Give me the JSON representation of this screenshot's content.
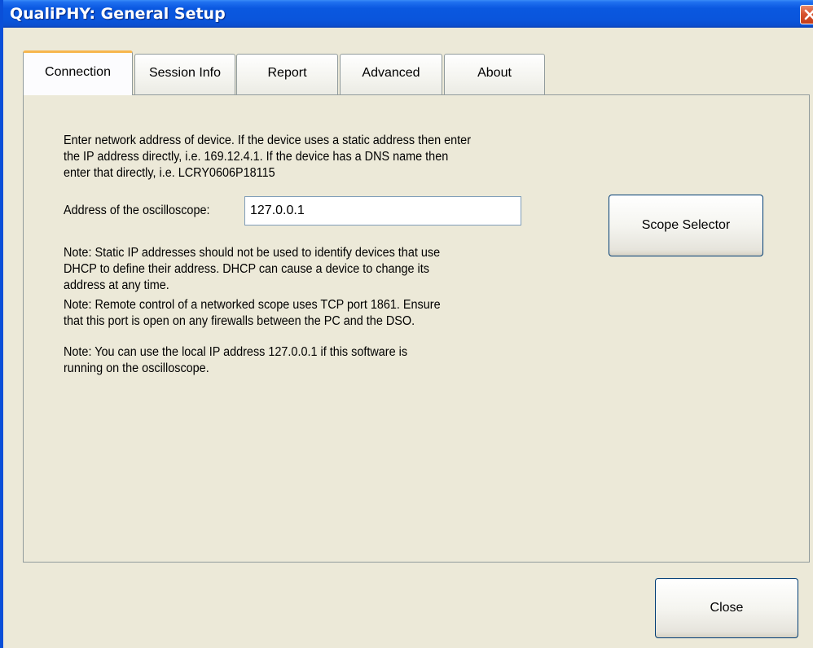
{
  "window": {
    "title": "QualiPHY: General Setup"
  },
  "tabs": [
    {
      "label": "Connection",
      "active": true
    },
    {
      "label": "Session Info",
      "active": false
    },
    {
      "label": "Report",
      "active": false
    },
    {
      "label": "Advanced",
      "active": false
    },
    {
      "label": "About",
      "active": false
    }
  ],
  "connection": {
    "intro_lines": [
      "Enter network address of device. If the device uses a static address then enter",
      "the IP address directly, i.e. 169.12.4.1. If the device has a DNS name then",
      "enter that directly, i.e. LCRY0606P18115"
    ],
    "address_label": "Address of the oscilloscope:",
    "address_value": "127.0.0.1",
    "scope_selector_label": "Scope Selector",
    "note1_lines": [
      "Note: Static IP addresses should not be used to identify devices that use",
      "DHCP to define their address. DHCP can cause a device to change its",
      "address at any time."
    ],
    "note2_lines": [
      "Note: Remote control of a networked scope uses TCP port 1861. Ensure",
      "that this port is open on any firewalls between the PC and the DSO."
    ],
    "note3_lines": [
      "Note: You can use the local IP address 127.0.0.1 if this software is",
      "running on the oscilloscope."
    ]
  },
  "footer": {
    "close_label": "Close"
  },
  "icons": {
    "window_close": "close-icon"
  },
  "colors": {
    "titlebar": "#0a55dc",
    "active_tab_accent": "#f7b64e",
    "panel": "#ece9d8",
    "close_button": "#d8542f"
  }
}
